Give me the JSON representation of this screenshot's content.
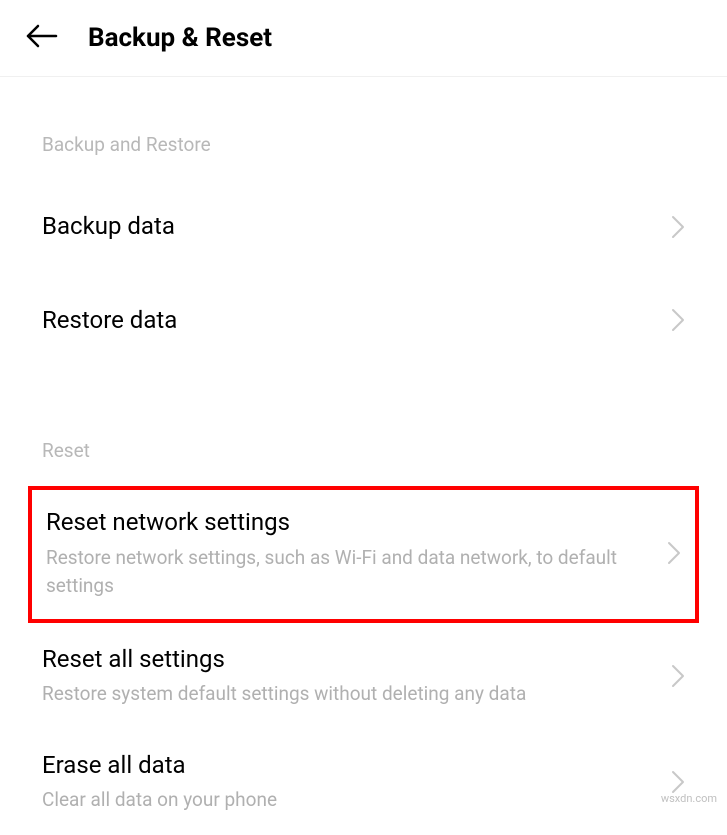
{
  "header": {
    "title": "Backup & Reset"
  },
  "sections": {
    "backup": {
      "header": "Backup and Restore",
      "items": {
        "backup_data": {
          "title": "Backup data"
        },
        "restore_data": {
          "title": "Restore data"
        }
      }
    },
    "reset": {
      "header": "Reset",
      "items": {
        "reset_network": {
          "title": "Reset network settings",
          "subtitle": "Restore network settings, such as Wi-Fi and data network, to default settings"
        },
        "reset_all": {
          "title": "Reset all settings",
          "subtitle": "Restore system default settings without deleting any data"
        },
        "erase_all": {
          "title": "Erase all data",
          "subtitle": "Clear all data on your phone"
        }
      }
    }
  },
  "watermark": "wsxdn.com"
}
